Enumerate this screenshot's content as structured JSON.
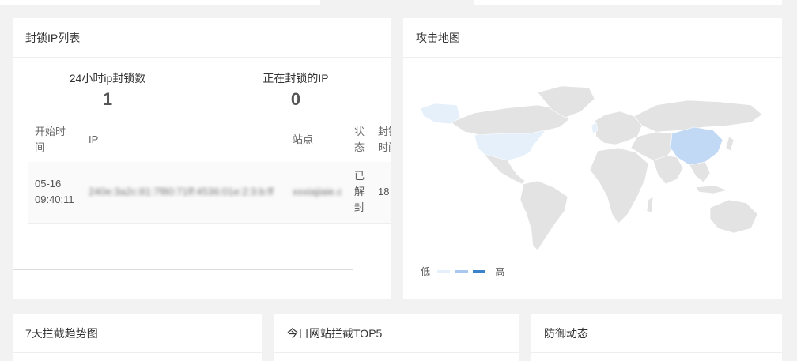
{
  "block_panel": {
    "title": "封锁IP列表",
    "stats": [
      {
        "label": "24小时ip封锁数",
        "value": "1"
      },
      {
        "label": "正在封锁的IP",
        "value": "0"
      }
    ],
    "columns": [
      "开始时间",
      "IP",
      "站点",
      "状态",
      "封锁时间"
    ],
    "rows": [
      {
        "start_time": "05-16 09:40:11",
        "ip": "240e:3a2c:81:7f80:71ff:4536:01e:2:3:b:ff",
        "site": "xxxiajiaie.cn",
        "status": "已解封",
        "block_time": "18"
      }
    ]
  },
  "map_panel": {
    "title": "攻击地图",
    "legend_low": "低",
    "legend_high": "高",
    "colors": {
      "base": "#e3e3e3",
      "low": "#e6f0fb",
      "mid": "#c2d9f5",
      "high": "#3a82c9"
    }
  },
  "bottom_panels": {
    "trend_title": "7天拦截趋势图",
    "top5_title": "今日网站拦截TOP5",
    "defense_title": "防御动态"
  }
}
